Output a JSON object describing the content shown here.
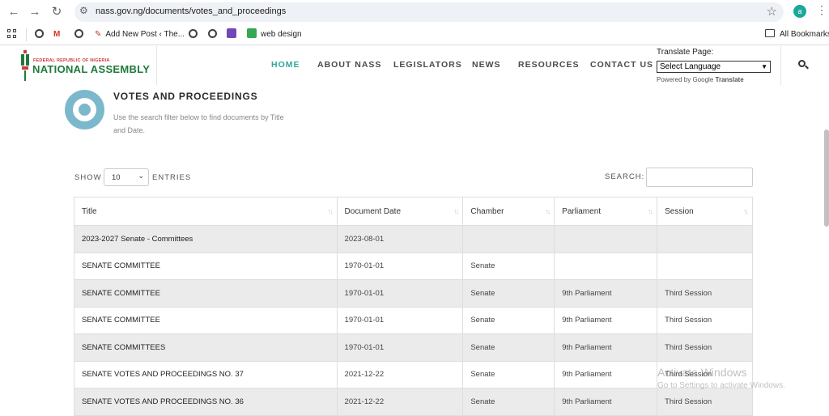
{
  "browser": {
    "url": "nass.gov.ng/documents/votes_and_proceedings",
    "profile_initial": "a",
    "bookmarks": [
      {
        "label": ""
      },
      {
        "label": ""
      },
      {
        "label": ""
      },
      {
        "label": "Add New Post ‹ The..."
      },
      {
        "label": ""
      },
      {
        "label": ""
      },
      {
        "label": ""
      },
      {
        "label": "web design"
      }
    ],
    "all_bookmarks": "All Bookmarks"
  },
  "site": {
    "logo_small": "FEDERAL REPUBLIC OF NIGERIA",
    "logo_big": "NATIONAL ASSEMBLY",
    "nav": [
      "HOME",
      "ABOUT NASS",
      "LEGISLATORS",
      "NEWS",
      "RESOURCES",
      "CONTACT US"
    ],
    "translate_label": "Translate Page:",
    "language_select": "Select Language",
    "powered_by": "Powered by",
    "google": "Google",
    "translate_word": "Translate"
  },
  "page": {
    "title": "VOTES AND PROCEEDINGS",
    "description": "Use the search filter below to find documents by Title and Date."
  },
  "controls": {
    "show": "SHOW",
    "entries_value": "10",
    "entries": "ENTRIES",
    "search": "SEARCH:"
  },
  "table": {
    "columns": [
      "Title",
      "Document Date",
      "Chamber",
      "Parliament",
      "Session"
    ],
    "rows": [
      [
        "2023-2027 Senate - Committees",
        "2023-08-01",
        "",
        "",
        ""
      ],
      [
        "SENATE COMMITTEE",
        "1970-01-01",
        "Senate",
        "",
        ""
      ],
      [
        "SENATE COMMITTEE",
        "1970-01-01",
        "Senate",
        "9th Parliament",
        "Third Session"
      ],
      [
        "SENATE COMMITTEE",
        "1970-01-01",
        "Senate",
        "9th Parliament",
        "Third Session"
      ],
      [
        "SENATE COMMITTEES",
        "1970-01-01",
        "Senate",
        "9th Parliament",
        "Third Session"
      ],
      [
        "SENATE VOTES AND PROCEEDINGS NO. 37",
        "2021-12-22",
        "Senate",
        "9th Parliament",
        "Third Session"
      ],
      [
        "SENATE VOTES AND PROCEEDINGS NO. 36",
        "2021-12-22",
        "Senate",
        "9th Parliament",
        "Third Session"
      ]
    ]
  },
  "watermark": {
    "line1": "Activate Windows",
    "line2": "Go to Settings to activate Windows."
  },
  "colors": {
    "accent": "#2fa89c",
    "logo_green": "#1f7a3a",
    "logo_red": "#d13a3a",
    "icon_blue": "#7bb8cc",
    "row_shade": "#ebebeb"
  }
}
